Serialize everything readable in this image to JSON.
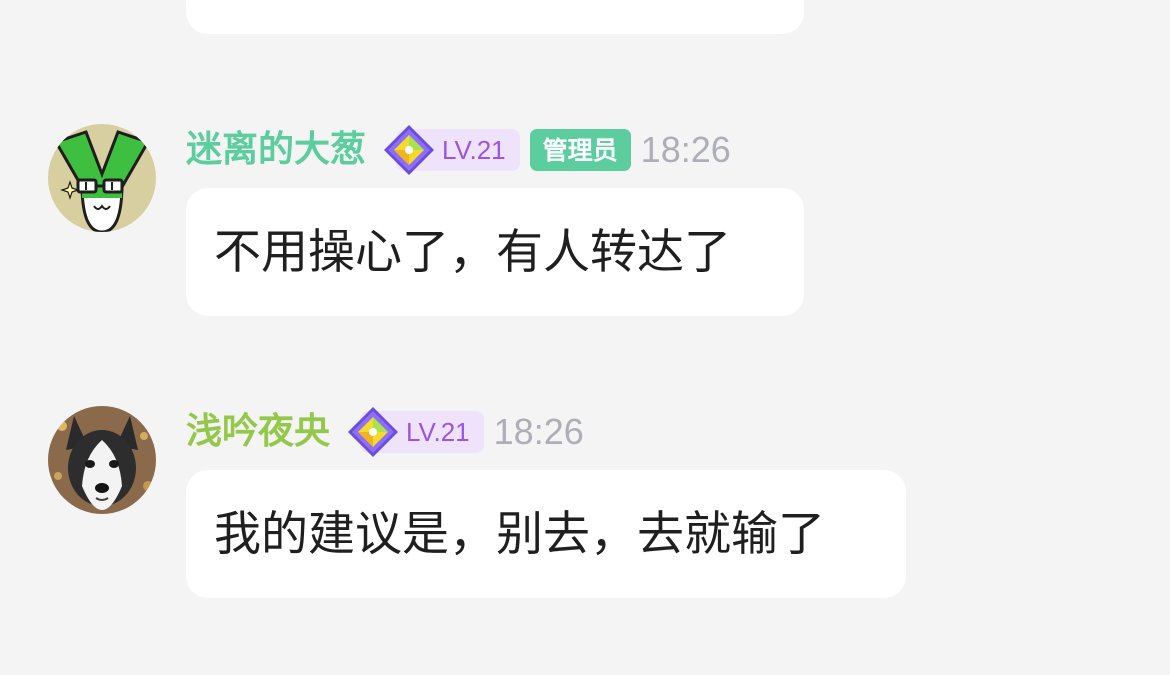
{
  "messages": [
    {
      "text": ""
    },
    {
      "username": "迷离的大葱",
      "username_color": "#5ccd9f",
      "level": "LV.21",
      "role_badge": "管理员",
      "role_badge_color": "#5ccd9f",
      "time": "18:26",
      "text": "不用操心了，有人转达了",
      "avatar_icon": "green-onion-cartoon-avatar"
    },
    {
      "username": "浅吟夜央",
      "username_color": "#93c84a",
      "level": "LV.21",
      "time": "18:26",
      "text": "我的建议是，别去，去就输了",
      "avatar_icon": "husky-dog-photo-avatar"
    }
  ],
  "colors": {
    "background": "#f4f4f4",
    "bubble": "#ffffff",
    "level_pill_bg": "#efe3fb",
    "level_text": "#9a55e6",
    "time_text": "#aeaeb8"
  }
}
